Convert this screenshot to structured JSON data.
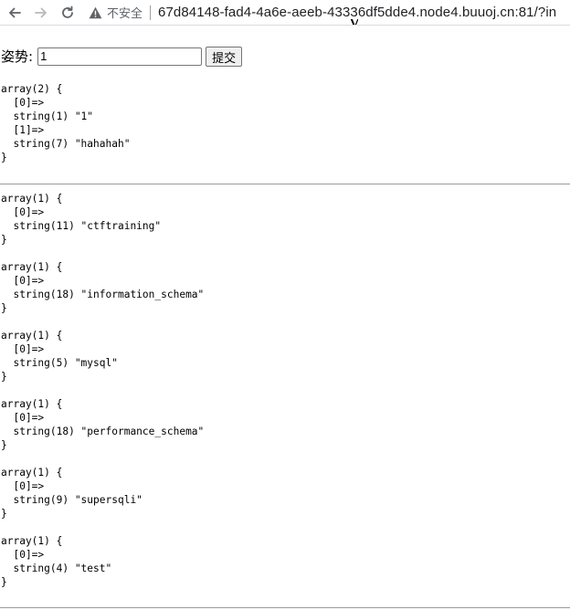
{
  "browser": {
    "security_label": "不安全",
    "url": "67d84148-fad4-4a6e-aeeb-43336df5dde4.node4.buuoj.cn:81/?in"
  },
  "page": {
    "title_fragment": "y"
  },
  "form": {
    "label": "姿势:",
    "input_value": "1",
    "submit_label": "提交"
  },
  "results_first": [
    "array(2) {\n  [0]=>\n  string(1) \"1\"\n  [1]=>\n  string(7) \"hahahah\"\n}"
  ],
  "results_second": [
    "array(1) {\n  [0]=>\n  string(11) \"ctftraining\"\n}",
    "array(1) {\n  [0]=>\n  string(18) \"information_schema\"\n}",
    "array(1) {\n  [0]=>\n  string(5) \"mysql\"\n}",
    "array(1) {\n  [0]=>\n  string(18) \"performance_schema\"\n}",
    "array(1) {\n  [0]=>\n  string(9) \"supersqli\"\n}",
    "array(1) {\n  [0]=>\n  string(4) \"test\"\n}"
  ],
  "icons": {
    "back": "arrow-left-icon",
    "forward": "arrow-right-icon",
    "reload": "reload-icon",
    "security": "warning-triangle-icon"
  }
}
